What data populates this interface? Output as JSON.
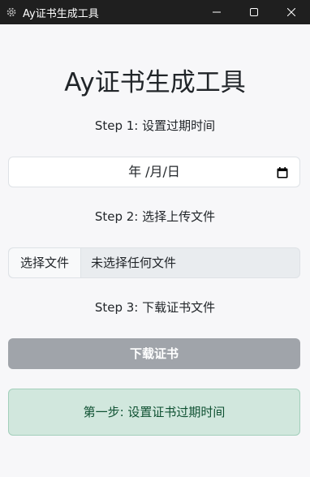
{
  "window": {
    "title": "Ay证书生成工具",
    "app_icon": "gear-icon",
    "controls": [
      "minimize-icon",
      "maximize-icon",
      "close-icon"
    ]
  },
  "main": {
    "title": "Ay证书生成工具",
    "step1_label": "Step 1: 设置过期时间",
    "date_display": "年 /月/日",
    "step2_label": "Step 2: 选择上传文件",
    "file_button_label": "选择文件",
    "file_status": "未选择任何文件",
    "step3_label": "Step 3: 下载证书文件",
    "download_button_label": "下载证书",
    "alert_message": "第一步: 设置证书过期时间"
  },
  "colors": {
    "titlebar": "#1f1f1f",
    "background": "#f7f7f9",
    "button_disabled": "#a0a4aa",
    "alert_bg": "#d1e7dd",
    "alert_text": "#0f5132"
  }
}
